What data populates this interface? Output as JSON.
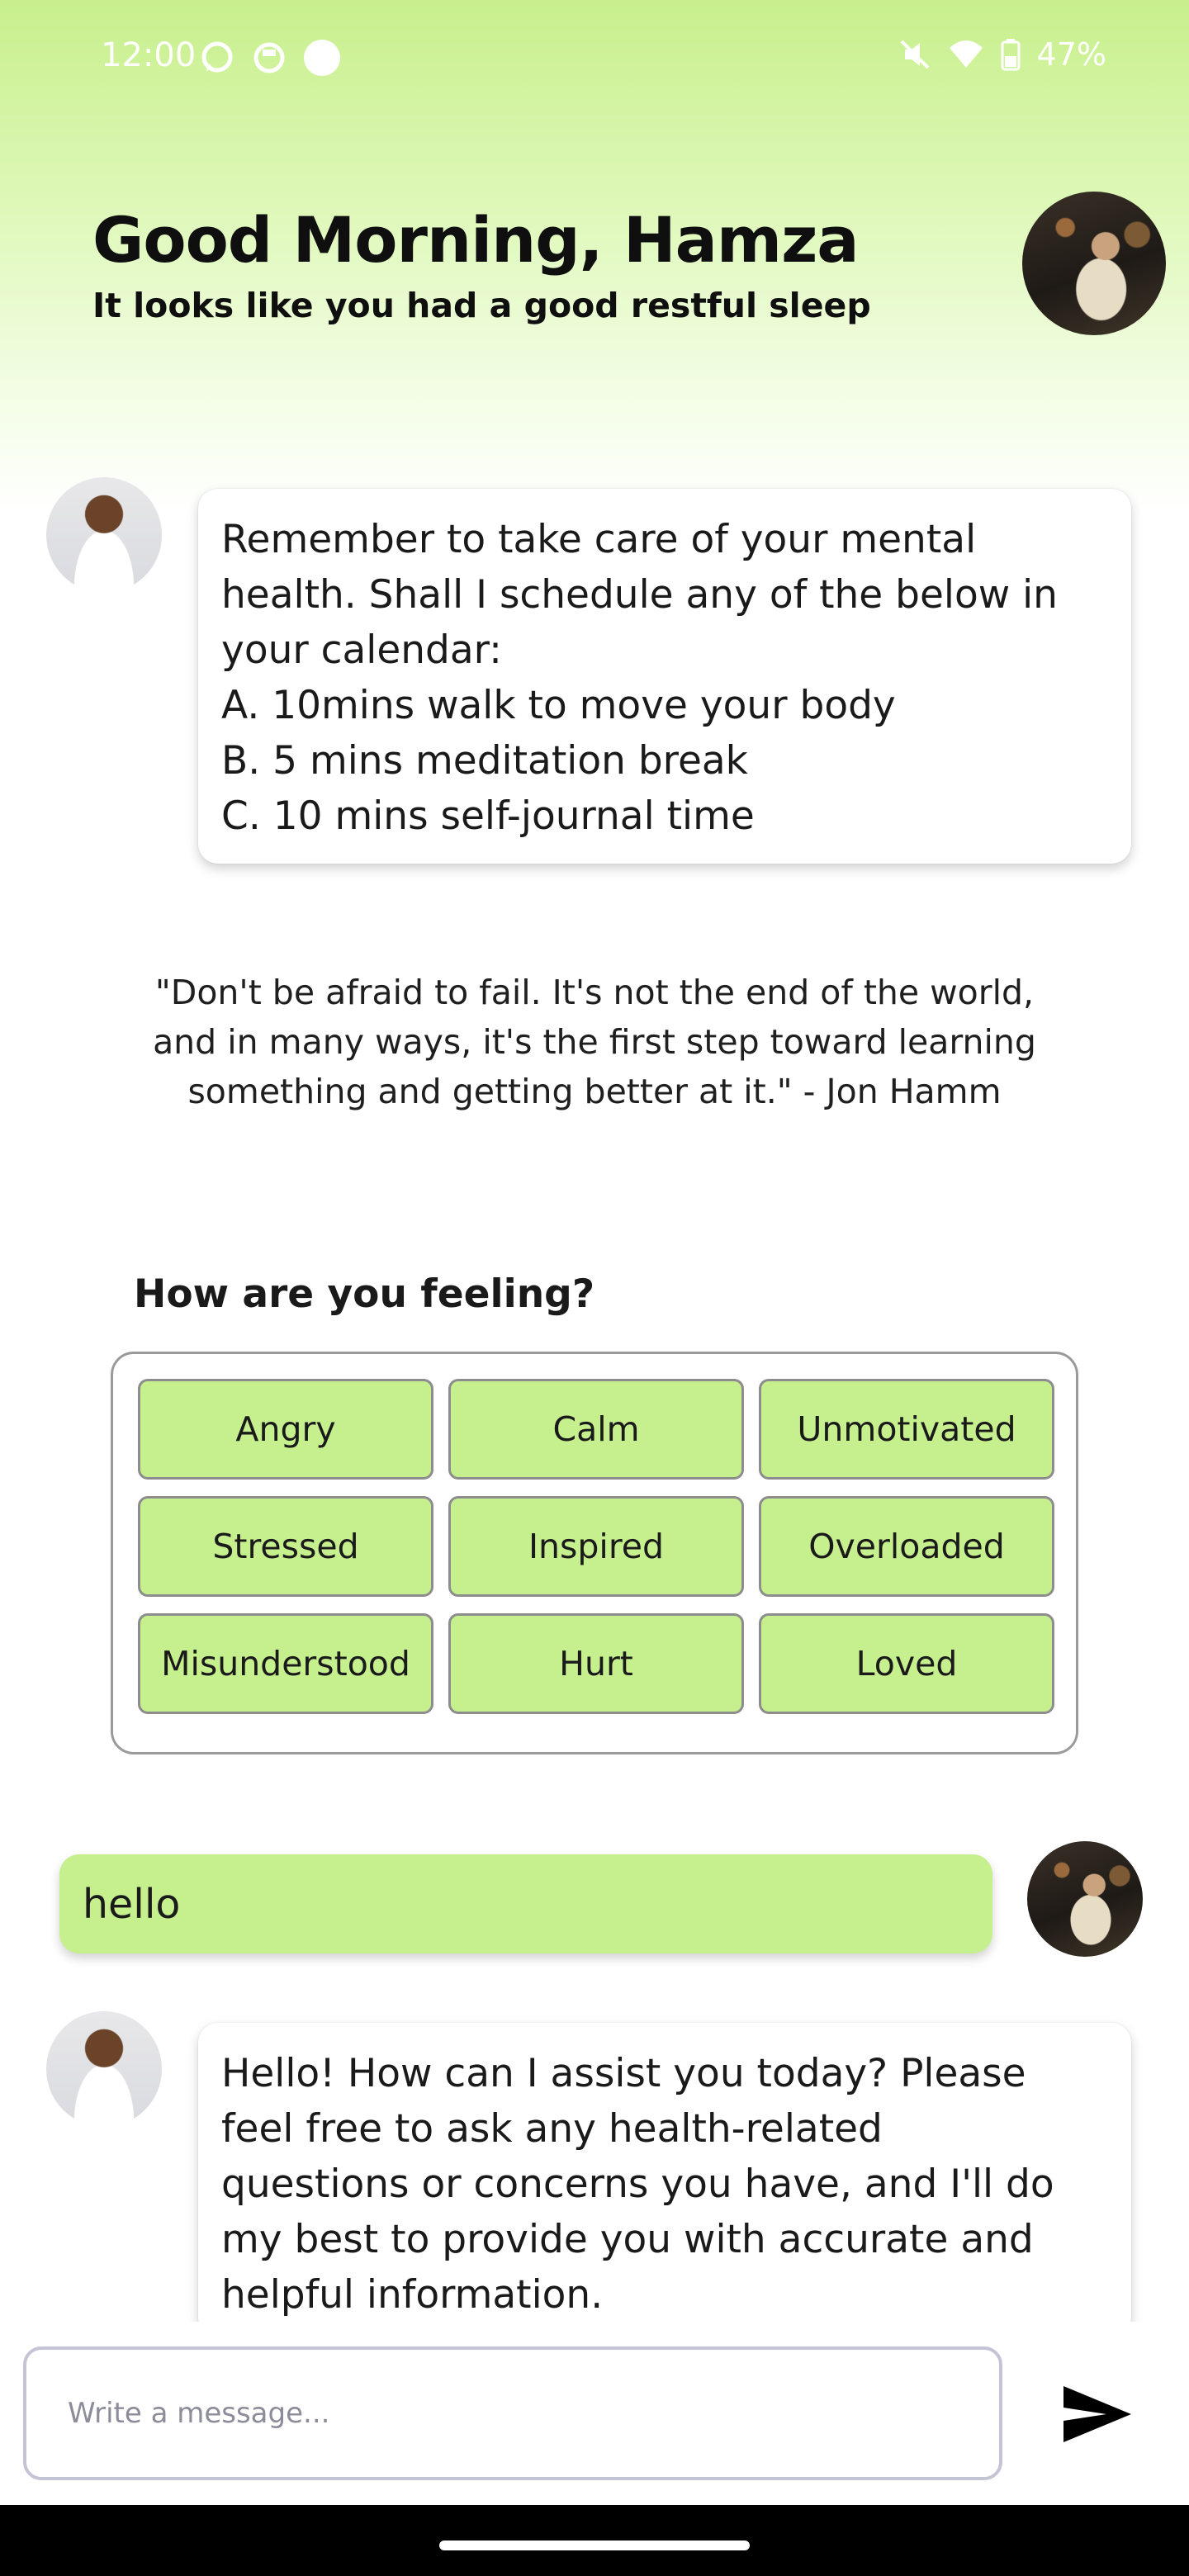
{
  "status_bar": {
    "time": "12:00",
    "left_icons": [
      "whatsapp-icon",
      "app-icon",
      "dot-icon"
    ],
    "right_icons": [
      "mute-icon",
      "wifi-icon",
      "battery-icon"
    ],
    "battery": "47%"
  },
  "header": {
    "greeting": "Good Morning, Hamza",
    "subtitle": "It looks like you had a good restful sleep"
  },
  "messages": [
    {
      "sender": "assistant",
      "lines": [
        "Remember to take care of your mental",
        "health. Shall I schedule any of the below in",
        "your calendar:",
        "A. 10mins walk to move your body",
        "B. 5 mins meditation break",
        "C. 10 mins self-journal time"
      ]
    },
    {
      "sender": "user",
      "text": "hello"
    },
    {
      "sender": "assistant",
      "lines": [
        "Hello! How can I assist you today? Please",
        "feel free to ask any health-related",
        "questions or concerns you have, and I'll do",
        "my best to provide you with accurate and",
        "helpful information."
      ]
    }
  ],
  "quote": {
    "lines": [
      "\"Don't be afraid to fail. It's not the end of the world,",
      "and in many ways, it's the first step toward learning",
      "something and getting better at it.\" - Jon Hamm"
    ]
  },
  "feelings": {
    "title": "How are you feeling?",
    "options": [
      "Angry",
      "Calm",
      "Unmotivated",
      "Stressed",
      "Inspired",
      "Overloaded",
      "Misunderstood",
      "Hurt",
      "Loved"
    ]
  },
  "composer": {
    "placeholder": "Write a message...",
    "send_icon": "send-icon"
  },
  "colors": {
    "accent_green": "#c6ef8e",
    "header_gradient_top": "#c8ef8c",
    "text_dark": "#1a1a1a"
  }
}
